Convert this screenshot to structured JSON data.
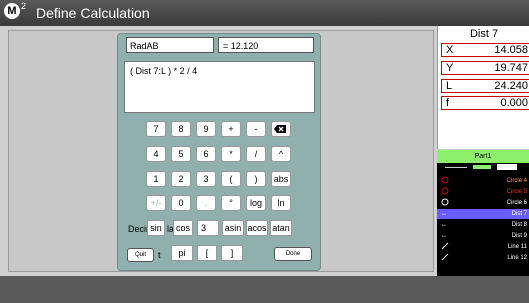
{
  "titlebar": {
    "logo": "M",
    "logo_sup": "2",
    "title": "Define Calculation"
  },
  "calc": {
    "name_value": "RadAB",
    "result": "= 12.120",
    "formula": "( Dist 7:L ) * 2 / 4",
    "row1": [
      "7",
      "8",
      "9",
      "+",
      "-"
    ],
    "row2": [
      "4",
      "5",
      "6",
      "*",
      "/",
      "^"
    ],
    "row3": [
      "1",
      "2",
      "3",
      "(",
      ")",
      "abs"
    ],
    "row4": [
      "+/-",
      "0",
      ".",
      "°",
      "log",
      "ln"
    ],
    "row5": {
      "decimals_label": "Decir",
      "sin": "sin",
      "cos_prefix": "la",
      "cos": "cos",
      "decimals_value": "3",
      "asin": "asin",
      "acos": "acos",
      "atan": "atan"
    },
    "row6": {
      "quit": "Quit",
      "t": "t",
      "pi": "pi",
      "lbracket": "[",
      "rbracket": "]",
      "done": "Done"
    }
  },
  "dist_panel": {
    "title": "Dist 7",
    "rows": [
      {
        "key": "X",
        "value": "14.058"
      },
      {
        "key": "Y",
        "value": "19.747"
      },
      {
        "key": "L",
        "value": "24.240"
      },
      {
        "key": "f",
        "value": "0.000"
      }
    ]
  },
  "features": {
    "header": "Part1",
    "items": [
      {
        "icon": "circle",
        "label": "Circle 4",
        "color": "#ff9a3a"
      },
      {
        "icon": "circle",
        "label": "Circle 5",
        "color": "#ff3030"
      },
      {
        "icon": "circle",
        "label": "Circle 6",
        "color": "#ffffff"
      },
      {
        "icon": "dist",
        "label": "Dist 7",
        "color": "#ffffff",
        "selected": true
      },
      {
        "icon": "dist",
        "label": "Dist 8",
        "color": "#ffffff"
      },
      {
        "icon": "dist",
        "label": "Dist 9",
        "color": "#ffffff"
      },
      {
        "icon": "line",
        "label": "Line 11",
        "color": "#ffffff"
      },
      {
        "icon": "line",
        "label": "Line 12",
        "color": "#ffffff"
      }
    ]
  }
}
